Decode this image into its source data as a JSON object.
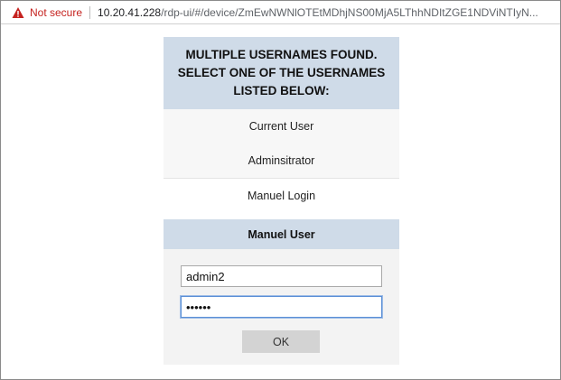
{
  "browser": {
    "security_label": "Not secure",
    "url_host": "10.20.41.228",
    "url_path": "/rdp-ui/#/device/ZmEwNWNlOTEtMDhjNS00MjA5LThhNDItZGE1NDViNTIyN..."
  },
  "dialog": {
    "title_lines": [
      "MULTIPLE USERNAMES FOUND.",
      "SELECT ONE OF THE USERNAMES",
      "LISTED BELOW:"
    ],
    "options": [
      "Current User",
      "Adminsitrator",
      "Manuel Login"
    ]
  },
  "manual": {
    "header": "Manuel User",
    "username_value": "admin2",
    "password_value": "••••••",
    "ok_label": "OK"
  },
  "colors": {
    "header_bg": "#cfdbe8",
    "not_secure": "#c5221f"
  }
}
